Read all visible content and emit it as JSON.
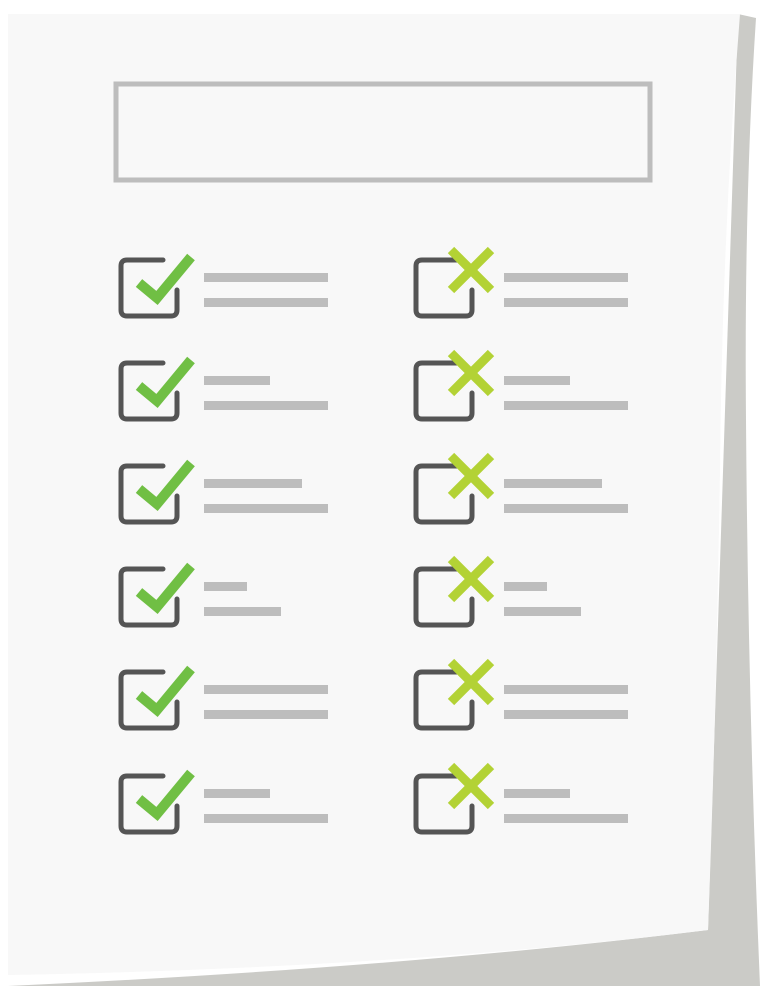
{
  "colors": {
    "page": "#f8f8f8",
    "page_shadow": "#cbcbc7",
    "title_box_border": "#bdbdbd",
    "checkbox_outline": "#555555",
    "check_mark": "#70bf44",
    "cross_mark": "#b3d235",
    "text_placeholder_line": "#bdbdbd"
  },
  "checklist": {
    "left_column": [
      {
        "state": "checked",
        "icon": "check-icon"
      },
      {
        "state": "checked",
        "icon": "check-icon"
      },
      {
        "state": "checked",
        "icon": "check-icon"
      },
      {
        "state": "checked",
        "icon": "check-icon"
      },
      {
        "state": "checked",
        "icon": "check-icon"
      },
      {
        "state": "checked",
        "icon": "check-icon"
      }
    ],
    "right_column": [
      {
        "state": "crossed",
        "icon": "cross-icon"
      },
      {
        "state": "crossed",
        "icon": "cross-icon"
      },
      {
        "state": "crossed",
        "icon": "cross-icon"
      },
      {
        "state": "crossed",
        "icon": "cross-icon"
      },
      {
        "state": "crossed",
        "icon": "cross-icon"
      },
      {
        "state": "crossed",
        "icon": "cross-icon"
      }
    ]
  }
}
